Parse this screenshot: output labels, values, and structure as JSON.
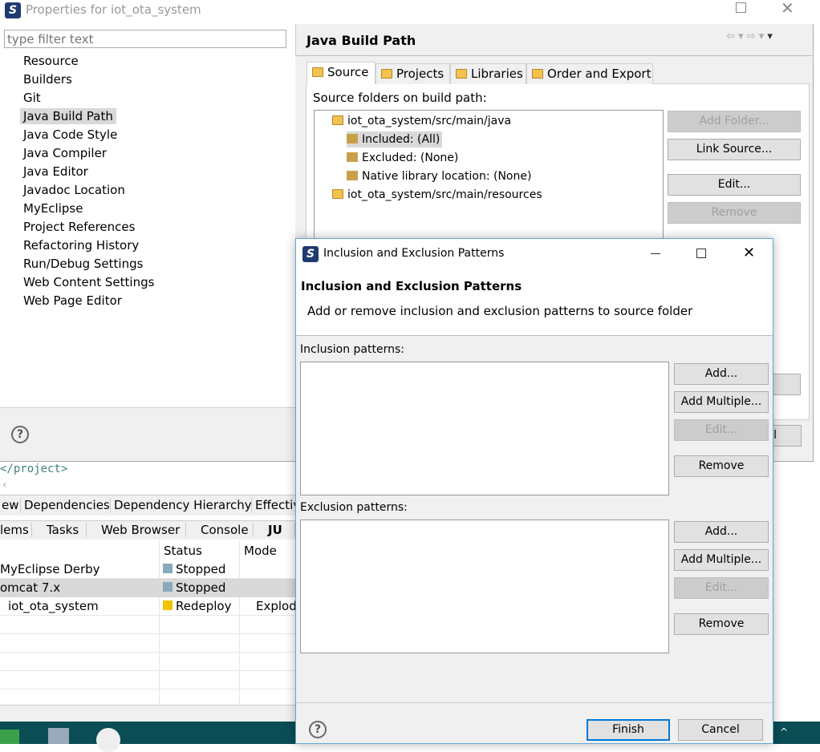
{
  "properties": {
    "title": "Properties for iot_ota_system",
    "filter_placeholder": "type filter text",
    "nav": [
      "Resource",
      "Builders",
      "Git",
      "Java Build Path",
      "Java Code Style",
      "Java Compiler",
      "Java Editor",
      "Javadoc Location",
      "MyEclipse",
      "Project References",
      "Refactoring History",
      "Run/Debug Settings",
      "Web Content Settings",
      "Web Page Editor"
    ],
    "selected_nav": "Java Build Path",
    "page_title": "Java Build Path",
    "tabs": [
      "Source",
      "Projects",
      "Libraries",
      "Order and Export"
    ],
    "active_tab": "Source",
    "source_label": "Source folders on build path:",
    "tree": [
      {
        "label": "iot_ota_system/src/main/java",
        "level": 0,
        "icon": "source-folder-icon"
      },
      {
        "label": "Included: (All)",
        "level": 1,
        "icon": "inclusion-filter-icon",
        "selected": true
      },
      {
        "label": "Excluded: (None)",
        "level": 1,
        "icon": "exclusion-filter-icon"
      },
      {
        "label": "Native library location: (None)",
        "level": 1,
        "icon": "native-library-icon"
      },
      {
        "label": "iot_ota_system/src/main/resources",
        "level": 0,
        "icon": "source-folder-icon"
      }
    ],
    "buttons": {
      "add_folder": "Add Folder...",
      "link_source": "Link Source...",
      "edit": "Edit...",
      "remove": "Remove",
      "cancel_partial": "el"
    }
  },
  "workspace": {
    "editor_text": "</project>",
    "editor_tabs": [
      "ew",
      "Dependencies",
      "Dependency Hierarchy",
      "Effectiv"
    ],
    "view_tabs": [
      "lems",
      "Tasks",
      "Web Browser",
      "Console",
      "JU"
    ],
    "columns": [
      "",
      "Status",
      "Mode"
    ],
    "rows": [
      {
        "name": "MyEclipse Derby",
        "status": "Stopped",
        "mode": ""
      },
      {
        "name": "omcat  7.x",
        "status": "Stopped",
        "mode": ""
      },
      {
        "name": "iot_ota_system",
        "status": "Redeploy",
        "mode": "Explod"
      }
    ]
  },
  "dialog": {
    "title": "Inclusion and Exclusion Patterns",
    "header": "Inclusion and Exclusion Patterns",
    "description": "Add or remove inclusion and exclusion patterns to source folder",
    "inclusion_label": "Inclusion patterns:",
    "exclusion_label": "Exclusion patterns:",
    "add": "Add...",
    "add_multiple": "Add Multiple...",
    "edit": "Edit...",
    "remove": "Remove",
    "finish": "Finish",
    "cancel": "Cancel"
  },
  "colors": {
    "accent": "#0078d7",
    "taskbar": "#0b4d55",
    "selection": "#d9d9d9"
  }
}
